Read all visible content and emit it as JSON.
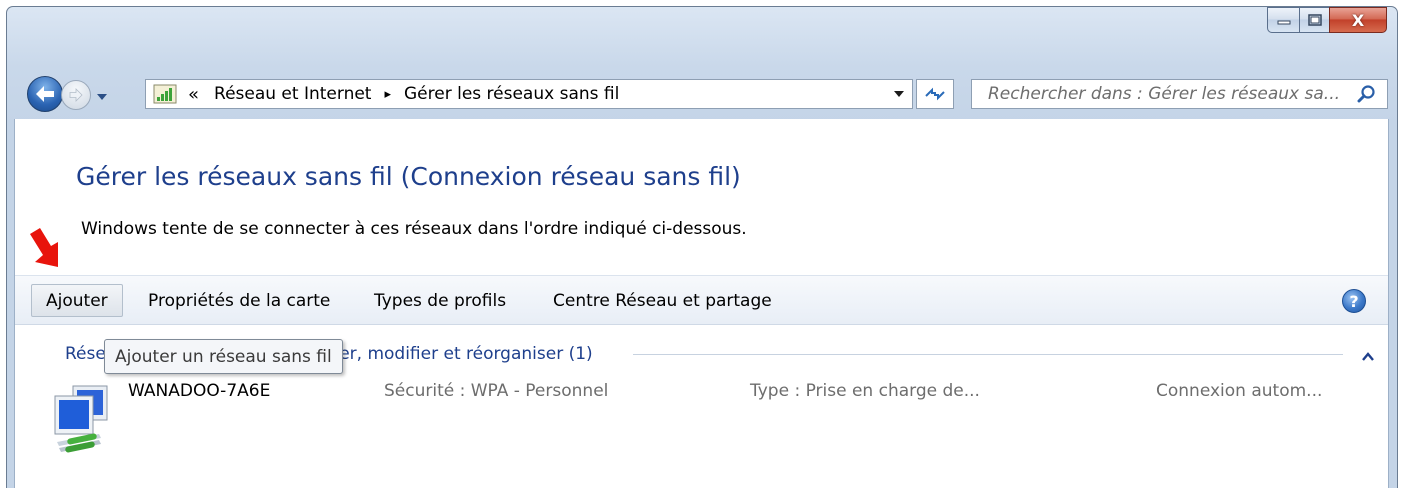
{
  "window": {
    "buttons": {
      "minimize": "minimize-icon",
      "maximize": "maximize-icon",
      "close_label": "X"
    }
  },
  "nav": {
    "breadcrumb": {
      "overflow": "«",
      "items": [
        "Réseau et Internet",
        "Gérer les réseaux sans fil"
      ],
      "separator": "▸"
    },
    "search": {
      "placeholder": "Rechercher dans : Gérer les réseaux sa..."
    }
  },
  "page": {
    "title": "Gérer les réseaux sans fil (Connexion réseau sans fil)",
    "description": "Windows tente de se connecter à ces réseaux dans l'ordre indiqué ci-dessous."
  },
  "toolbar": {
    "items": [
      "Ajouter",
      "Propriétés de la carte",
      "Types de profils",
      "Centre Réseau et partage"
    ],
    "help_label": "?"
  },
  "group": {
    "header": "Réseaux que vous pouvez afficher, modifier et réorganiser (1)"
  },
  "tooltip": {
    "text": "Ajouter un réseau sans fil"
  },
  "networks": [
    {
      "name": "WANADOO-7A6E",
      "security": "Sécurité : WPA - Personnel",
      "type": "Type : Prise en charge de...",
      "mode": "Connexion autom..."
    }
  ],
  "colors": {
    "link_blue": "#1e3f8c",
    "annotation_red": "#e8140c",
    "close_red": "#c2412b"
  }
}
